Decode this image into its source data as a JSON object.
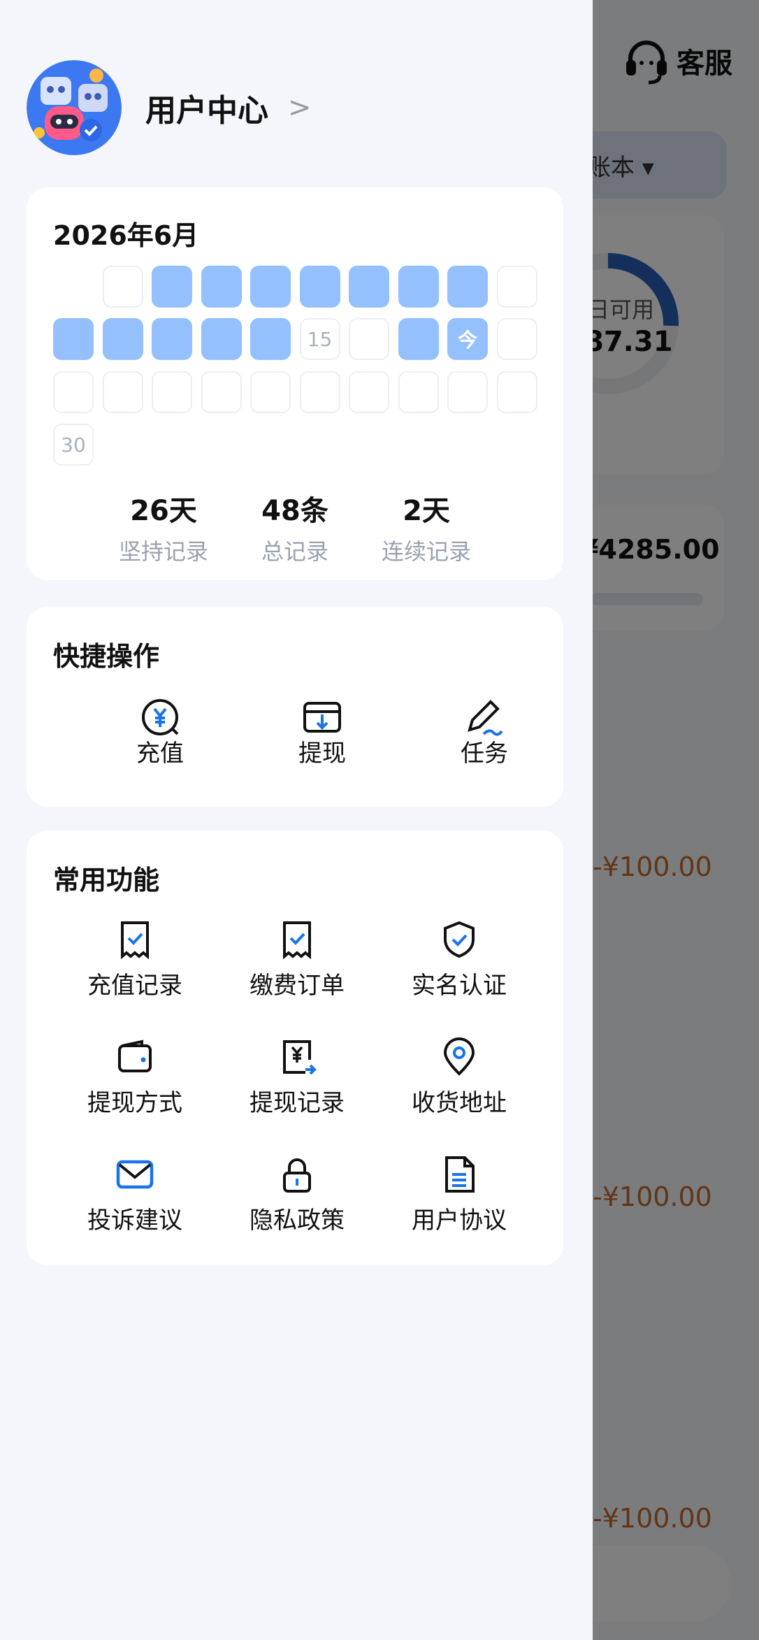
{
  "background": {
    "service_label": "客服",
    "book_label": "账本 ▾",
    "available_label": "日可用",
    "available_value": "87.31",
    "total_amount": "¥4285.00",
    "amounts": [
      "-¥100.00",
      "-¥100.00",
      "-¥100.00"
    ]
  },
  "drawer": {
    "profile": {
      "name": "用户中心",
      "chevron": ">"
    },
    "calendar": {
      "title": "2026年6月",
      "days": [
        {
          "day": 1,
          "filled": false
        },
        {
          "day": 2,
          "filled": true
        },
        {
          "day": 3,
          "filled": true
        },
        {
          "day": 4,
          "filled": true
        },
        {
          "day": 5,
          "filled": true
        },
        {
          "day": 6,
          "filled": true
        },
        {
          "day": 7,
          "filled": true
        },
        {
          "day": 8,
          "filled": true
        },
        {
          "day": 9,
          "filled": false
        },
        {
          "day": 10,
          "filled": true
        },
        {
          "day": 11,
          "filled": true
        },
        {
          "day": 12,
          "filled": true
        },
        {
          "day": 13,
          "filled": true
        },
        {
          "day": 14,
          "filled": true
        },
        {
          "day": 15,
          "filled": false,
          "label": "15"
        },
        {
          "day": 16,
          "filled": false
        },
        {
          "day": 17,
          "filled": true
        },
        {
          "day": 18,
          "filled": true,
          "label": "今",
          "today": true
        },
        {
          "day": 19,
          "filled": false
        },
        {
          "day": 20,
          "filled": false
        },
        {
          "day": 21,
          "filled": false
        },
        {
          "day": 22,
          "filled": false
        },
        {
          "day": 23,
          "filled": false
        },
        {
          "day": 24,
          "filled": false
        },
        {
          "day": 25,
          "filled": false
        },
        {
          "day": 26,
          "filled": false
        },
        {
          "day": 27,
          "filled": false
        },
        {
          "day": 28,
          "filled": false
        },
        {
          "day": 29,
          "filled": false
        },
        {
          "day": 30,
          "filled": false,
          "label": "30"
        }
      ],
      "leading_blank_cells": 1,
      "stats": [
        {
          "value": "26天",
          "label": "坚持记录"
        },
        {
          "value": "48条",
          "label": "总记录"
        },
        {
          "value": "2天",
          "label": "连续记录"
        }
      ]
    },
    "quick_ops": {
      "title": "快捷操作",
      "items": [
        {
          "label": "充值",
          "icon": "recharge-icon"
        },
        {
          "label": "提现",
          "icon": "withdraw-icon"
        },
        {
          "label": "任务",
          "icon": "task-pen-icon"
        }
      ]
    },
    "common": {
      "title": "常用功能",
      "items": [
        {
          "label": "充值记录",
          "icon": "receipt-check-icon"
        },
        {
          "label": "缴费订单",
          "icon": "receipt-check-icon"
        },
        {
          "label": "实名认证",
          "icon": "shield-check-icon"
        },
        {
          "label": "提现方式",
          "icon": "wallet-icon"
        },
        {
          "label": "提现记录",
          "icon": "yen-document-icon"
        },
        {
          "label": "收货地址",
          "icon": "location-pin-icon"
        },
        {
          "label": "投诉建议",
          "icon": "mail-icon"
        },
        {
          "label": "隐私政策",
          "icon": "lock-icon"
        },
        {
          "label": "用户协议",
          "icon": "document-icon"
        }
      ]
    }
  },
  "colors": {
    "accent_blue": "#1a73e8",
    "calendar_fill": "#94c1fd",
    "overlay": "rgba(0,0,0,0.5)",
    "expense": "#c76a2a"
  }
}
